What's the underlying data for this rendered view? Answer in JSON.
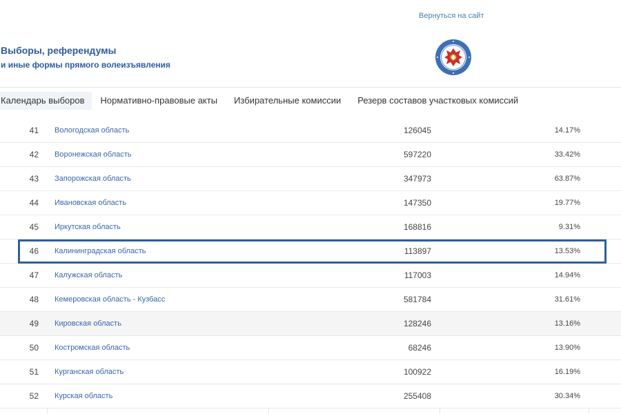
{
  "header": {
    "back_link": "Вернуться на сайт",
    "title": "Выборы, референдумы",
    "subtitle": "и иные формы прямого волеизъявления",
    "emblem_icon": "cik-emblem-icon"
  },
  "nav": {
    "items": [
      {
        "label": "Календарь выборов",
        "active": true
      },
      {
        "label": "Нормативно-правовые акты",
        "active": false
      },
      {
        "label": "Избирательные комиссии",
        "active": false
      },
      {
        "label": "Резерв составов участковых комиссий",
        "active": false
      }
    ]
  },
  "table": {
    "rows": [
      {
        "num": "41",
        "name": "Вологодская область",
        "votes": "126045",
        "percent": "14.17%"
      },
      {
        "num": "42",
        "name": "Воронежская область",
        "votes": "597220",
        "percent": "33.42%"
      },
      {
        "num": "43",
        "name": "Запорожская область",
        "votes": "347973",
        "percent": "63.87%"
      },
      {
        "num": "44",
        "name": "Ивановская область",
        "votes": "147350",
        "percent": "19.77%"
      },
      {
        "num": "45",
        "name": "Иркутская область",
        "votes": "168816",
        "percent": "9.31%"
      },
      {
        "num": "46",
        "name": "Калининградская область",
        "votes": "113897",
        "percent": "13.53%"
      },
      {
        "num": "47",
        "name": "Калужская область",
        "votes": "117003",
        "percent": "14.94%"
      },
      {
        "num": "48",
        "name": "Кемеровская область - Кузбасс",
        "votes": "581784",
        "percent": "31.61%"
      },
      {
        "num": "49",
        "name": "Кировская область",
        "votes": "128246",
        "percent": "13.16%"
      },
      {
        "num": "50",
        "name": "Костромская область",
        "votes": "68246",
        "percent": "13.90%"
      },
      {
        "num": "51",
        "name": "Курганская область",
        "votes": "100922",
        "percent": "16.19%"
      },
      {
        "num": "52",
        "name": "Курская область",
        "votes": "255408",
        "percent": "30.34%"
      }
    ],
    "highlighted_row": "46",
    "hover_row": "49"
  },
  "colors": {
    "title": "#2f5a9e",
    "link": "#3866a8",
    "highlight_border": "#2f5f99"
  }
}
